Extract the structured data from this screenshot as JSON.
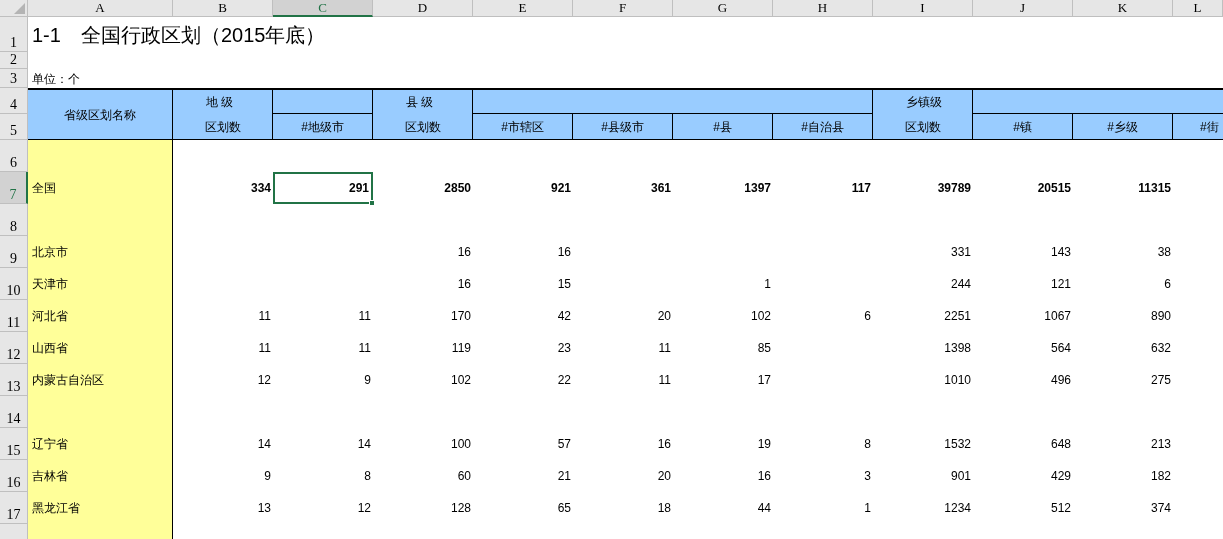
{
  "column_letters": [
    {
      "label": "A",
      "selected": false
    },
    {
      "label": "B",
      "selected": false
    },
    {
      "label": "C",
      "selected": true
    },
    {
      "label": "D",
      "selected": false
    },
    {
      "label": "E",
      "selected": false
    },
    {
      "label": "F",
      "selected": false
    },
    {
      "label": "G",
      "selected": false
    },
    {
      "label": "H",
      "selected": false
    },
    {
      "label": "I",
      "selected": false
    },
    {
      "label": "J",
      "selected": false
    },
    {
      "label": "K",
      "selected": false
    },
    {
      "label": "L",
      "selected": false
    }
  ],
  "row_numbers": [
    {
      "label": "1",
      "selected": false
    },
    {
      "label": "2",
      "selected": false
    },
    {
      "label": "3",
      "selected": false
    },
    {
      "label": "4",
      "selected": false
    },
    {
      "label": "5",
      "selected": false
    },
    {
      "label": "6",
      "selected": false
    },
    {
      "label": "7",
      "selected": true
    },
    {
      "label": "8",
      "selected": false
    },
    {
      "label": "9",
      "selected": false
    },
    {
      "label": "10",
      "selected": false
    },
    {
      "label": "11",
      "selected": false
    },
    {
      "label": "12",
      "selected": false
    },
    {
      "label": "13",
      "selected": false
    },
    {
      "label": "14",
      "selected": false
    },
    {
      "label": "15",
      "selected": false
    },
    {
      "label": "16",
      "selected": false
    },
    {
      "label": "17",
      "selected": false
    }
  ],
  "title": "1-1　全国行政区划（2015年底）",
  "unit": "单位：个",
  "first_column_header": "省级区划名称",
  "header_groups": [
    {
      "label": "地 级",
      "sub_label": "区划数",
      "items": [
        "#地级市"
      ]
    },
    {
      "label": "县 级",
      "sub_label": "区划数",
      "items": [
        "#市辖区",
        "#县级市",
        "#县",
        "#自治县"
      ]
    },
    {
      "label": "乡镇级",
      "sub_label": "区划数",
      "items": [
        "#镇",
        "#乡级",
        "#街"
      ]
    }
  ],
  "rows": [
    {
      "kind": "blank"
    },
    {
      "kind": "total",
      "name": "全国",
      "cells": [
        {
          "value": "334",
          "selected": false
        },
        {
          "value": "291",
          "selected": true
        },
        {
          "value": "2850",
          "selected": false
        },
        {
          "value": "921",
          "selected": false
        },
        {
          "value": "361",
          "selected": false
        },
        {
          "value": "1397",
          "selected": false
        },
        {
          "value": "117",
          "selected": false
        },
        {
          "value": "39789",
          "selected": false
        },
        {
          "value": "20515",
          "selected": false
        },
        {
          "value": "11315",
          "selected": false
        }
      ]
    },
    {
      "kind": "blank"
    },
    {
      "kind": "data",
      "name": "北京市",
      "cells": [
        null,
        null,
        {
          "value": "16",
          "selected": false
        },
        {
          "value": "16",
          "selected": false
        },
        null,
        null,
        null,
        {
          "value": "331",
          "selected": false
        },
        {
          "value": "143",
          "selected": false
        },
        {
          "value": "38",
          "selected": false
        }
      ]
    },
    {
      "kind": "data",
      "name": "天津市",
      "cells": [
        null,
        null,
        {
          "value": "16",
          "selected": false
        },
        {
          "value": "15",
          "selected": false
        },
        null,
        {
          "value": "1",
          "selected": false
        },
        null,
        {
          "value": "244",
          "selected": false
        },
        {
          "value": "121",
          "selected": false
        },
        {
          "value": "6",
          "selected": false
        }
      ]
    },
    {
      "kind": "data",
      "name": "河北省",
      "cells": [
        {
          "value": "11",
          "selected": false
        },
        {
          "value": "11",
          "selected": false
        },
        {
          "value": "170",
          "selected": false
        },
        {
          "value": "42",
          "selected": false
        },
        {
          "value": "20",
          "selected": false
        },
        {
          "value": "102",
          "selected": false
        },
        {
          "value": "6",
          "selected": false
        },
        {
          "value": "2251",
          "selected": false
        },
        {
          "value": "1067",
          "selected": false
        },
        {
          "value": "890",
          "selected": false
        }
      ]
    },
    {
      "kind": "data",
      "name": "山西省",
      "cells": [
        {
          "value": "11",
          "selected": false
        },
        {
          "value": "11",
          "selected": false
        },
        {
          "value": "119",
          "selected": false
        },
        {
          "value": "23",
          "selected": false
        },
        {
          "value": "11",
          "selected": false
        },
        {
          "value": "85",
          "selected": false
        },
        null,
        {
          "value": "1398",
          "selected": false
        },
        {
          "value": "564",
          "selected": false
        },
        {
          "value": "632",
          "selected": false
        }
      ]
    },
    {
      "kind": "data",
      "name": "内蒙古自治区",
      "cells": [
        {
          "value": "12",
          "selected": false
        },
        {
          "value": "9",
          "selected": false
        },
        {
          "value": "102",
          "selected": false
        },
        {
          "value": "22",
          "selected": false
        },
        {
          "value": "11",
          "selected": false
        },
        {
          "value": "17",
          "selected": false
        },
        null,
        {
          "value": "1010",
          "selected": false
        },
        {
          "value": "496",
          "selected": false
        },
        {
          "value": "275",
          "selected": false
        }
      ]
    },
    {
      "kind": "blank"
    },
    {
      "kind": "data",
      "name": "辽宁省",
      "cells": [
        {
          "value": "14",
          "selected": false
        },
        {
          "value": "14",
          "selected": false
        },
        {
          "value": "100",
          "selected": false
        },
        {
          "value": "57",
          "selected": false
        },
        {
          "value": "16",
          "selected": false
        },
        {
          "value": "19",
          "selected": false
        },
        {
          "value": "8",
          "selected": false
        },
        {
          "value": "1532",
          "selected": false
        },
        {
          "value": "648",
          "selected": false
        },
        {
          "value": "213",
          "selected": false
        }
      ]
    },
    {
      "kind": "data",
      "name": "吉林省",
      "cells": [
        {
          "value": "9",
          "selected": false
        },
        {
          "value": "8",
          "selected": false
        },
        {
          "value": "60",
          "selected": false
        },
        {
          "value": "21",
          "selected": false
        },
        {
          "value": "20",
          "selected": false
        },
        {
          "value": "16",
          "selected": false
        },
        {
          "value": "3",
          "selected": false
        },
        {
          "value": "901",
          "selected": false
        },
        {
          "value": "429",
          "selected": false
        },
        {
          "value": "182",
          "selected": false
        }
      ]
    },
    {
      "kind": "data",
      "name": "黑龙江省",
      "cells": [
        {
          "value": "13",
          "selected": false
        },
        {
          "value": "12",
          "selected": false
        },
        {
          "value": "128",
          "selected": false
        },
        {
          "value": "65",
          "selected": false
        },
        {
          "value": "18",
          "selected": false
        },
        {
          "value": "44",
          "selected": false
        },
        {
          "value": "1",
          "selected": false
        },
        {
          "value": "1234",
          "selected": false
        },
        {
          "value": "512",
          "selected": false
        },
        {
          "value": "374",
          "selected": false
        }
      ]
    }
  ]
}
